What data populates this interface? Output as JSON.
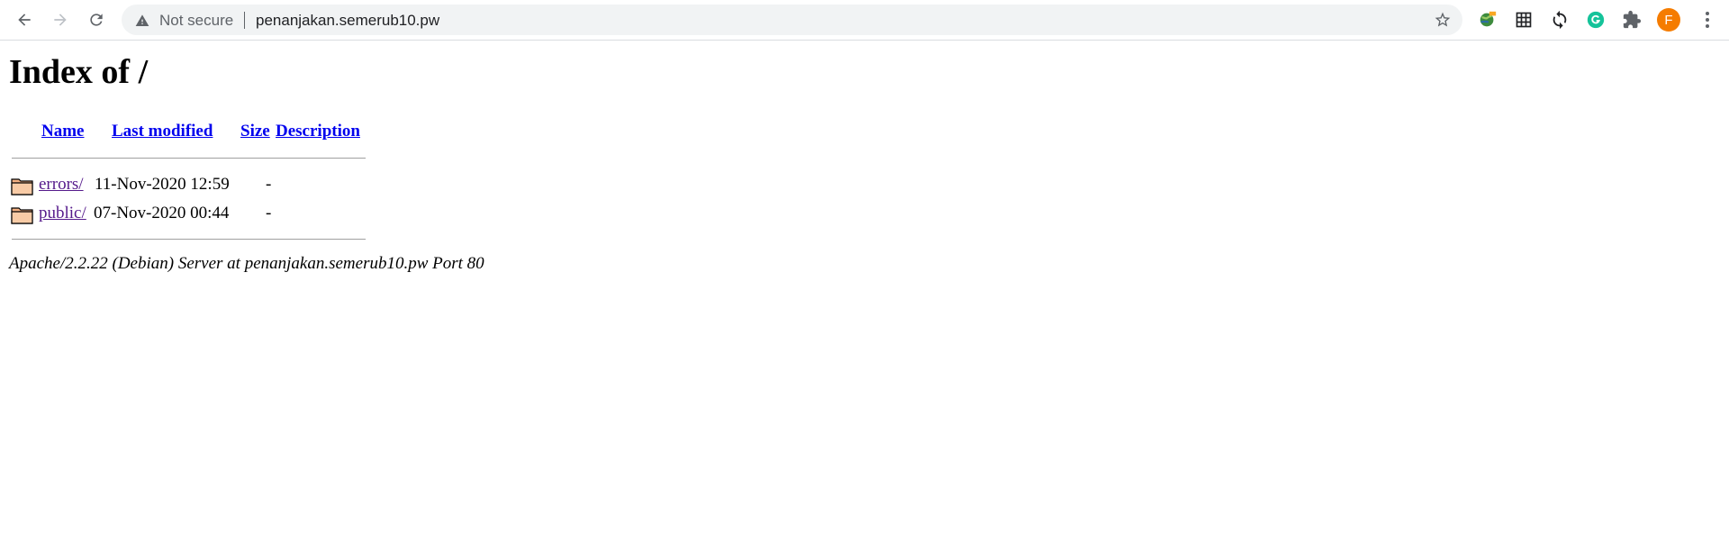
{
  "browser": {
    "security_label": "Not secure",
    "url": "penanjakan.semerub10.pw",
    "avatar_initial": "F",
    "avatar_color": "#f57c00",
    "extensions": [
      "globe-extension-icon",
      "grid-extension-icon",
      "sync-extension-icon",
      "grammarly-icon",
      "puzzle-extensions-icon"
    ]
  },
  "page": {
    "title": "Index of /",
    "columns": {
      "name": "Name",
      "last_modified": "Last modified",
      "size": "Size",
      "description": "Description"
    },
    "entries": [
      {
        "name": "errors/",
        "last_modified": "11-Nov-2020 12:59",
        "size": "-",
        "description": ""
      },
      {
        "name": "public/",
        "last_modified": "07-Nov-2020 00:44",
        "size": "-",
        "description": ""
      }
    ],
    "footer": "Apache/2.2.22 (Debian) Server at penanjakan.semerub10.pw Port 80"
  }
}
